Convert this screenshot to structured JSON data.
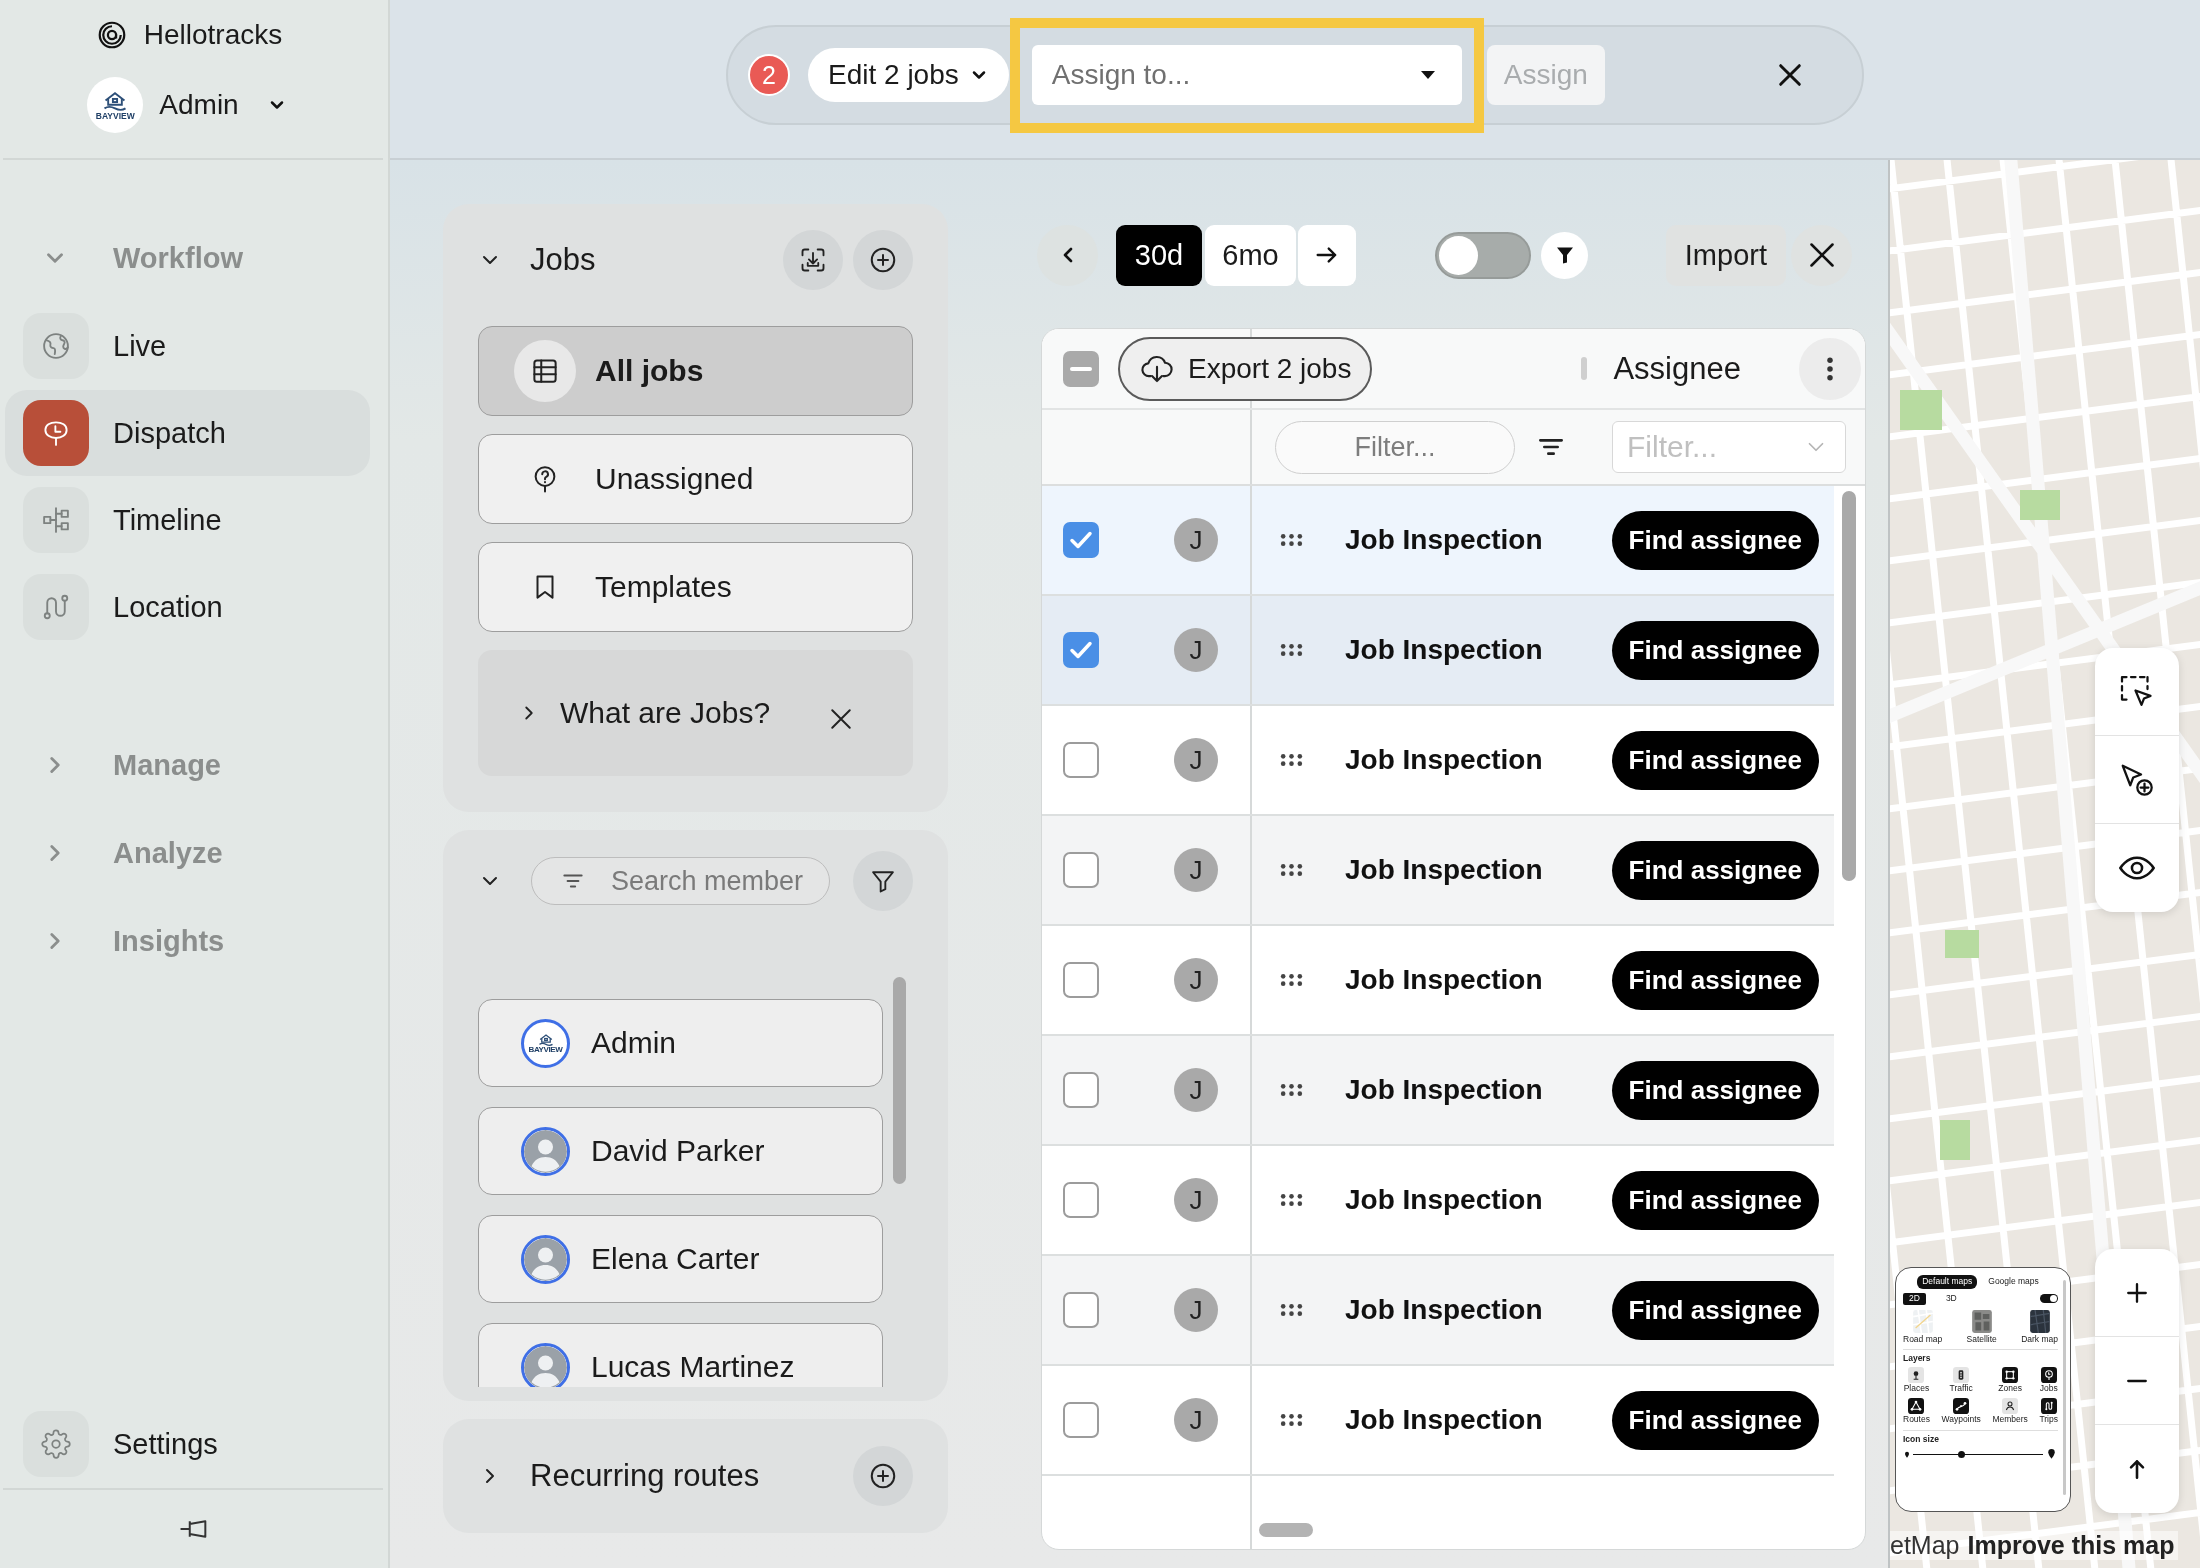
{
  "app": {
    "name": "Hellotracks",
    "account": {
      "name": "Admin",
      "logo_text": "BAYVIEW"
    }
  },
  "sidebar": {
    "sections": [
      {
        "label": "Workflow",
        "expanded": true,
        "items": [
          {
            "label": "Live",
            "selected": false
          },
          {
            "label": "Dispatch",
            "selected": true
          },
          {
            "label": "Timeline",
            "selected": false
          },
          {
            "label": "Location",
            "selected": false
          }
        ]
      },
      {
        "label": "Manage",
        "expanded": false
      },
      {
        "label": "Analyze",
        "expanded": false
      },
      {
        "label": "Insights",
        "expanded": false
      }
    ],
    "settings": {
      "label": "Settings",
      "selected": false
    }
  },
  "selection_bar": {
    "count": "2",
    "edit_menu": "Edit 2 jobs",
    "assign_field": {
      "placeholder": "Assign to...",
      "highlighted": true
    },
    "assign_button": {
      "label": "Assign",
      "disabled": true
    }
  },
  "jobs_panel": {
    "title": "Jobs",
    "expanded": true,
    "views": [
      {
        "label": "All jobs",
        "selected": true
      },
      {
        "label": "Unassigned",
        "selected": false
      },
      {
        "label": "Templates",
        "selected": false
      }
    ],
    "help": {
      "label": "What are Jobs?",
      "expanded": false
    }
  },
  "members_panel": {
    "expanded": true,
    "search": {
      "placeholder": "Search member"
    },
    "members": [
      {
        "name": "Admin",
        "logo_text": "BAYVIEW"
      },
      {
        "name": "David Parker"
      },
      {
        "name": "Elena Carter"
      },
      {
        "name": "Lucas Martinez"
      }
    ]
  },
  "routes_panel": {
    "title": "Recurring routes",
    "expanded": false
  },
  "jobs_toolbar": {
    "ranges": [
      {
        "label": "30d",
        "selected": true
      },
      {
        "label": "6mo",
        "selected": false
      }
    ],
    "toggle": {
      "on": false
    },
    "import_button": "Import"
  },
  "table": {
    "select_all": {
      "indeterminate": true
    },
    "export_button": "Export 2 jobs",
    "assignee_header": "Assignee",
    "filters": [
      {
        "kind": "text",
        "placeholder": "Filter..."
      },
      {
        "kind": "select",
        "placeholder": "Filter..."
      }
    ],
    "rows": [
      {
        "checked": true,
        "avatar": "J",
        "title": "Job Inspection",
        "action": "Find assignee"
      },
      {
        "checked": true,
        "avatar": "J",
        "title": "Job Inspection",
        "action": "Find assignee"
      },
      {
        "checked": false,
        "avatar": "J",
        "title": "Job Inspection",
        "action": "Find assignee"
      },
      {
        "checked": false,
        "avatar": "J",
        "title": "Job Inspection",
        "action": "Find assignee"
      },
      {
        "checked": false,
        "avatar": "J",
        "title": "Job Inspection",
        "action": "Find assignee"
      },
      {
        "checked": false,
        "avatar": "J",
        "title": "Job Inspection",
        "action": "Find assignee"
      },
      {
        "checked": false,
        "avatar": "J",
        "title": "Job Inspection",
        "action": "Find assignee"
      },
      {
        "checked": false,
        "avatar": "J",
        "title": "Job Inspection",
        "action": "Find assignee"
      },
      {
        "checked": false,
        "avatar": "J",
        "title": "Job Inspection",
        "action": "Find assignee"
      }
    ]
  },
  "map": {
    "layers_panel": {
      "sources": [
        {
          "label": "Default maps",
          "selected": true
        },
        {
          "label": "Google maps",
          "selected": false
        }
      ],
      "views": [
        {
          "label": "2D",
          "selected": true
        },
        {
          "label": "3D",
          "selected": false
        }
      ],
      "toggle": {
        "on": true
      },
      "styles": [
        {
          "label": "Road map"
        },
        {
          "label": "Satellite"
        },
        {
          "label": "Dark map"
        }
      ],
      "layers_title": "Layers",
      "layers": [
        {
          "label": "Places",
          "on": false
        },
        {
          "label": "Traffic",
          "on": false
        },
        {
          "label": "Zones",
          "on": true
        },
        {
          "label": "Jobs",
          "on": true
        },
        {
          "label": "Routes",
          "on": true
        },
        {
          "label": "Waypoints",
          "on": true
        },
        {
          "label": "Members",
          "on": false
        },
        {
          "label": "Trips",
          "on": true
        }
      ],
      "icon_size": {
        "label": "Icon size",
        "level": 0.37
      }
    },
    "attribution": "etMap",
    "improve_link": "Improve this map"
  }
}
